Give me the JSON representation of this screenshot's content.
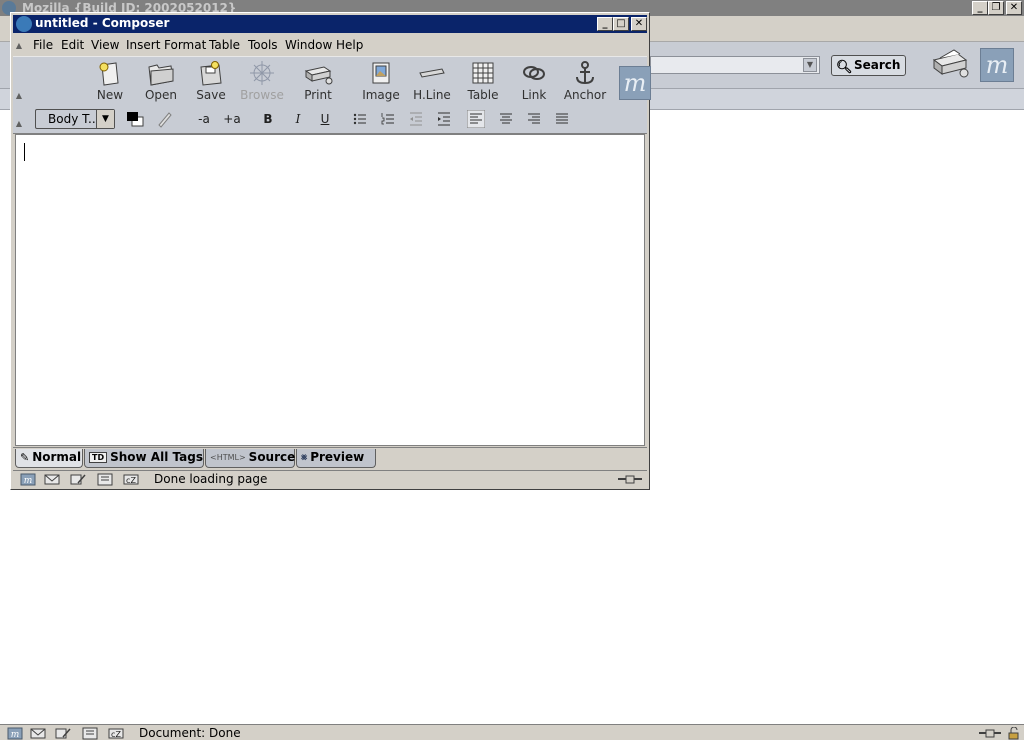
{
  "background_window": {
    "title": "Mozilla {Build ID: 2002052012}",
    "search_label": "Search",
    "status_text": "Document: Done",
    "controls": {
      "minimize": "_",
      "restore": "❐",
      "close": "✕"
    }
  },
  "composer": {
    "title": "untitled - Composer",
    "controls": {
      "minimize": "_",
      "maximize": "□",
      "close": "✕"
    },
    "menu": [
      "File",
      "Edit",
      "View",
      "Insert",
      "Format",
      "Table",
      "Tools",
      "Window",
      "Help"
    ],
    "toolbar": [
      {
        "label": "New",
        "icon": "new-page-icon",
        "enabled": true
      },
      {
        "label": "Open",
        "icon": "folder-icon",
        "enabled": true
      },
      {
        "label": "Save",
        "icon": "save-icon",
        "enabled": true
      },
      {
        "label": "Browse",
        "icon": "browse-icon",
        "enabled": false
      },
      {
        "label": "Print",
        "icon": "printer-icon",
        "enabled": true
      },
      {
        "label": "Image",
        "icon": "image-icon",
        "enabled": true
      },
      {
        "label": "H.Line",
        "icon": "hline-icon",
        "enabled": true
      },
      {
        "label": "Table",
        "icon": "table-icon",
        "enabled": true
      },
      {
        "label": "Link",
        "icon": "link-icon",
        "enabled": true
      },
      {
        "label": "Anchor",
        "icon": "anchor-icon",
        "enabled": true
      }
    ],
    "format": {
      "paragraph_style": "Body T...",
      "smaller_font": "-a",
      "larger_font": "+a",
      "bold": "B",
      "italic": "I",
      "underline": "U"
    },
    "tabs": [
      {
        "label": "Normal",
        "icon": "normal-pencil-icon",
        "active": true
      },
      {
        "label": "Show All Tags",
        "icon": "td-tag-icon",
        "icon_text": "TD",
        "active": false
      },
      {
        "label": "Source",
        "icon": "html-source-icon",
        "icon_text": "<HTML>",
        "active": false
      },
      {
        "label": "Preview",
        "icon": "preview-icon",
        "active": false
      }
    ],
    "status_text": "Done loading page"
  }
}
